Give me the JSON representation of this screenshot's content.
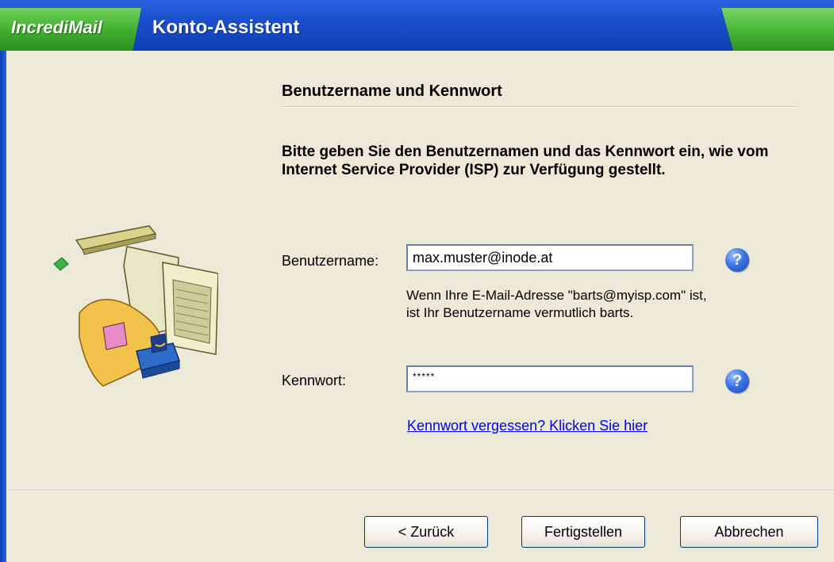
{
  "window": {
    "brand": "IncrediMail",
    "title": "Konto-Assistent"
  },
  "page": {
    "heading": "Benutzername und Kennwort",
    "instruction": "Bitte geben Sie den Benutzernamen und das Kennwort ein, wie vom Internet Service Provider (ISP) zur Verfügung gestellt."
  },
  "username": {
    "label": "Benutzername:",
    "value": "max.muster@inode.at",
    "hint_line1": "Wenn Ihre E-Mail-Adresse \"barts@myisp.com\" ist,",
    "hint_line2": "ist Ihr Benutzername vermutlich barts."
  },
  "password": {
    "label": "Kennwort:",
    "masked_value": "*****"
  },
  "help_icon_glyph": "?",
  "forgot_link": "Kennwort vergessen? Klicken Sie hier",
  "buttons": {
    "back": "< Zurück",
    "finish": "Fertigstellen",
    "cancel": "Abbrechen"
  },
  "colors": {
    "title_bar_blue": "#1B4FCB",
    "brand_green": "#3FAE2E",
    "dialog_background": "#ECE9D8",
    "link_blue": "#0000EE"
  },
  "icons": {
    "help": "question-mark-help-icon",
    "illustration": "computer-setup-illustration"
  }
}
